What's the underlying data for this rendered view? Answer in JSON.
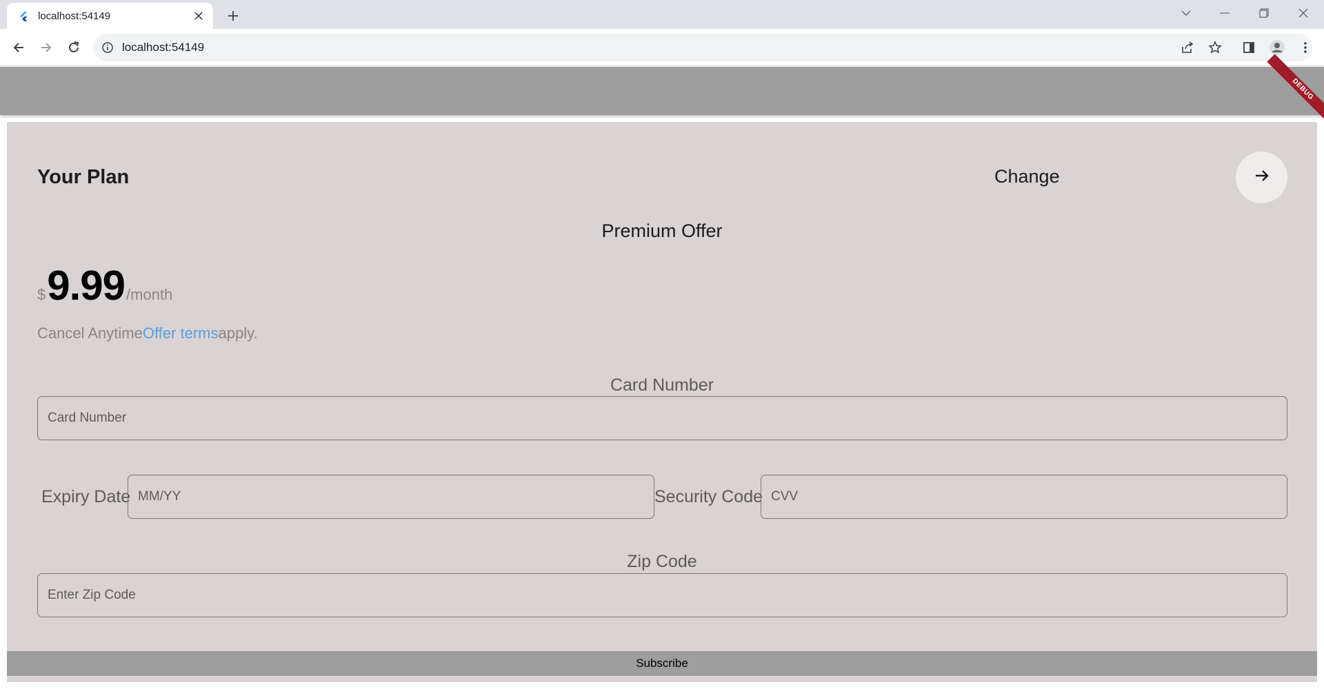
{
  "browser": {
    "tab_title": "localhost:54149",
    "url": "localhost:54149"
  },
  "app": {
    "debug_banner": "DEBUG",
    "plan_title": "Your Plan",
    "change_label": "Change",
    "offer_title": "Premium Offer",
    "price": {
      "currency": "$",
      "amount": "9.99",
      "period": "/month"
    },
    "terms": {
      "prefix": "Cancel Anytime",
      "link": "Offer terms",
      "suffix": "apply."
    },
    "card_number": {
      "label": "Card Number",
      "placeholder": "Card Number"
    },
    "expiry": {
      "label": "Expiry Date",
      "placeholder": "MM/YY"
    },
    "security": {
      "label": "Security Code",
      "placeholder": "CVV"
    },
    "zip": {
      "label": "Zip Code",
      "placeholder": "Enter Zip Code"
    },
    "subscribe_label": "Subscribe"
  },
  "colors": {
    "appbar": "#9e9e9e",
    "card_background": "#d9d3d3",
    "link": "#5aa0e0",
    "debug_banner": "#a01c28"
  }
}
